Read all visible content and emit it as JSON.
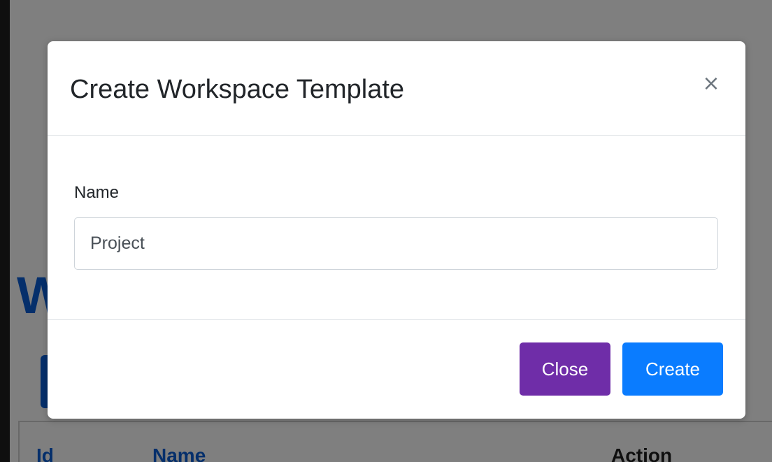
{
  "background_page": {
    "heading_visible": "W",
    "table": {
      "columns": [
        "Id",
        "Name",
        "Action"
      ]
    }
  },
  "modal": {
    "title": "Create Workspace Template",
    "close_icon": "×",
    "form": {
      "name_label": "Name",
      "name_value": "Project"
    },
    "footer": {
      "close_label": "Close",
      "create_label": "Create"
    }
  },
  "colors": {
    "close_button": "#6f2da8",
    "create_button": "#0a7cff",
    "page_accent": "#0b5ed7",
    "backdrop": "rgba(0,0,0,0.5)"
  }
}
